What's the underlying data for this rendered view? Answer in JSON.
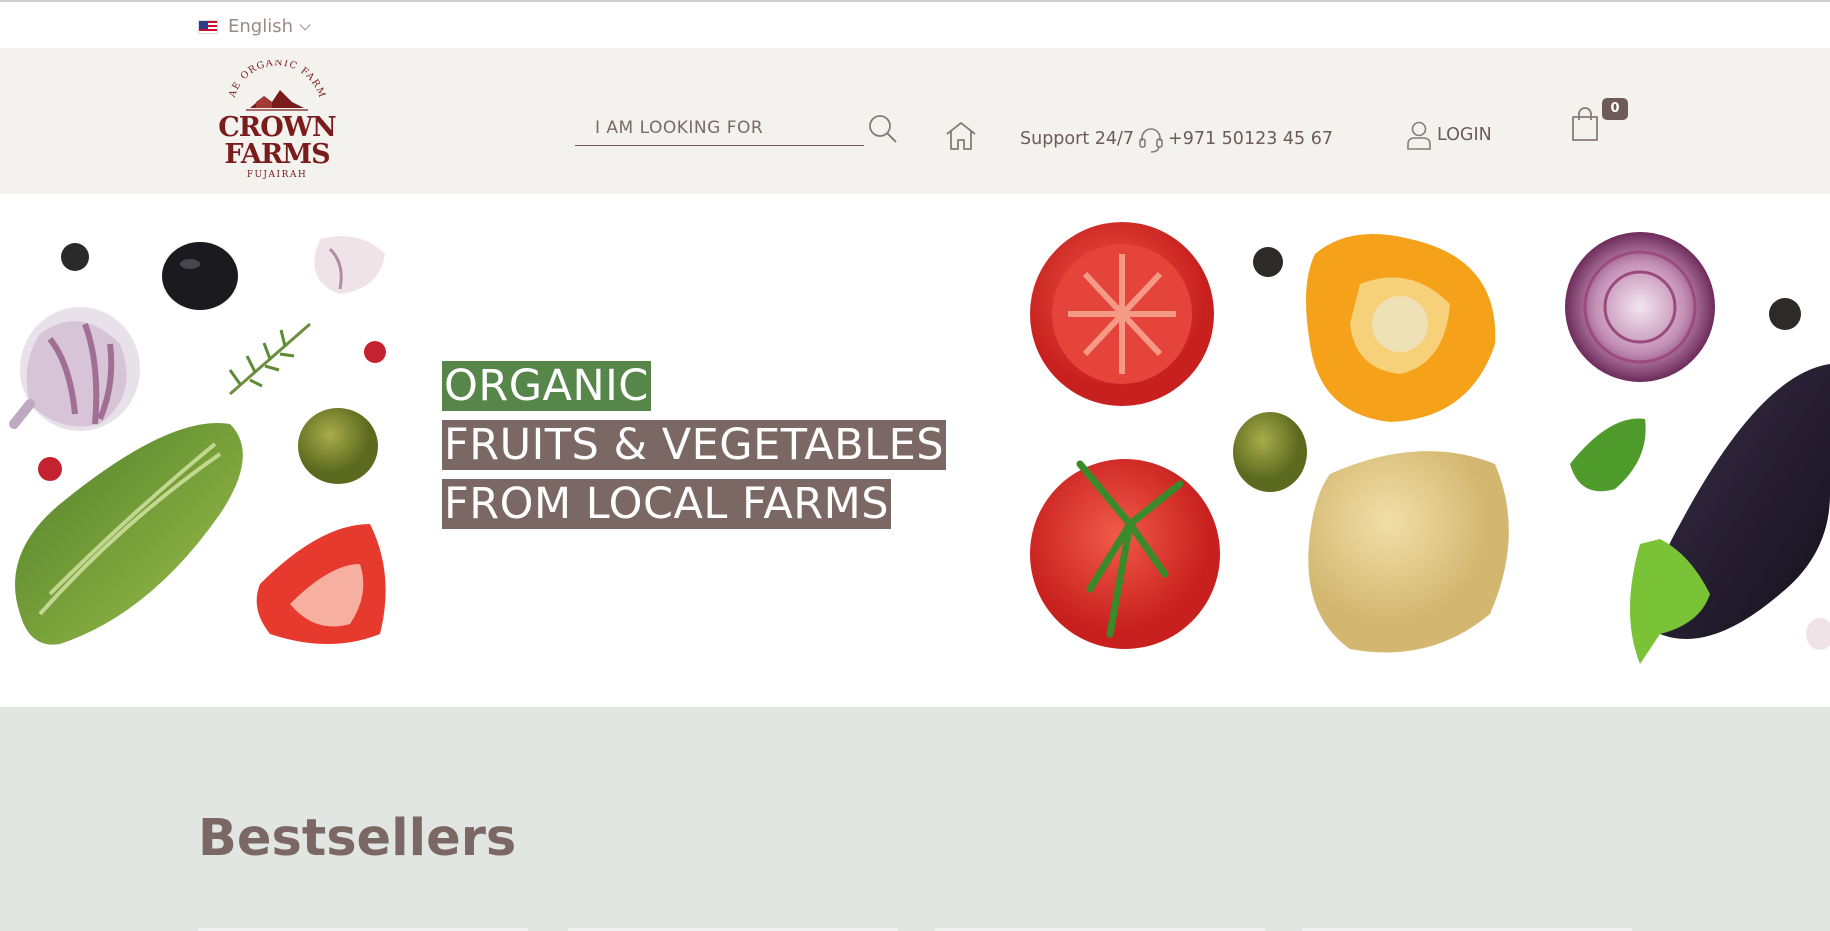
{
  "language": {
    "label": "English",
    "flag": "us-flag-icon"
  },
  "logo": {
    "arc_text": "UAE ORGANIC FARMS",
    "line1": "CROWN",
    "line2": "FARMS",
    "sub": "FUJAIRAH",
    "color": "#7a1c1c"
  },
  "search": {
    "placeholder": "I AM LOOKING FOR",
    "value": ""
  },
  "support": {
    "label": "Support 24/7",
    "phone": "+971 50123 45 67"
  },
  "login": {
    "label": "LOGIN"
  },
  "cart": {
    "count": "0"
  },
  "hero": {
    "lines": [
      "ORGANIC",
      "FRUITS & VEGETABLES",
      "FROM LOCAL FARMS"
    ],
    "highlight_green": "#57864a",
    "highlight_brown": "#7b6864"
  },
  "bestsellers": {
    "title": "Bestsellers"
  },
  "colors": {
    "brand": "#6e5b57",
    "header_bg": "#f3f2ef",
    "section_bg": "#e2e6e3"
  }
}
